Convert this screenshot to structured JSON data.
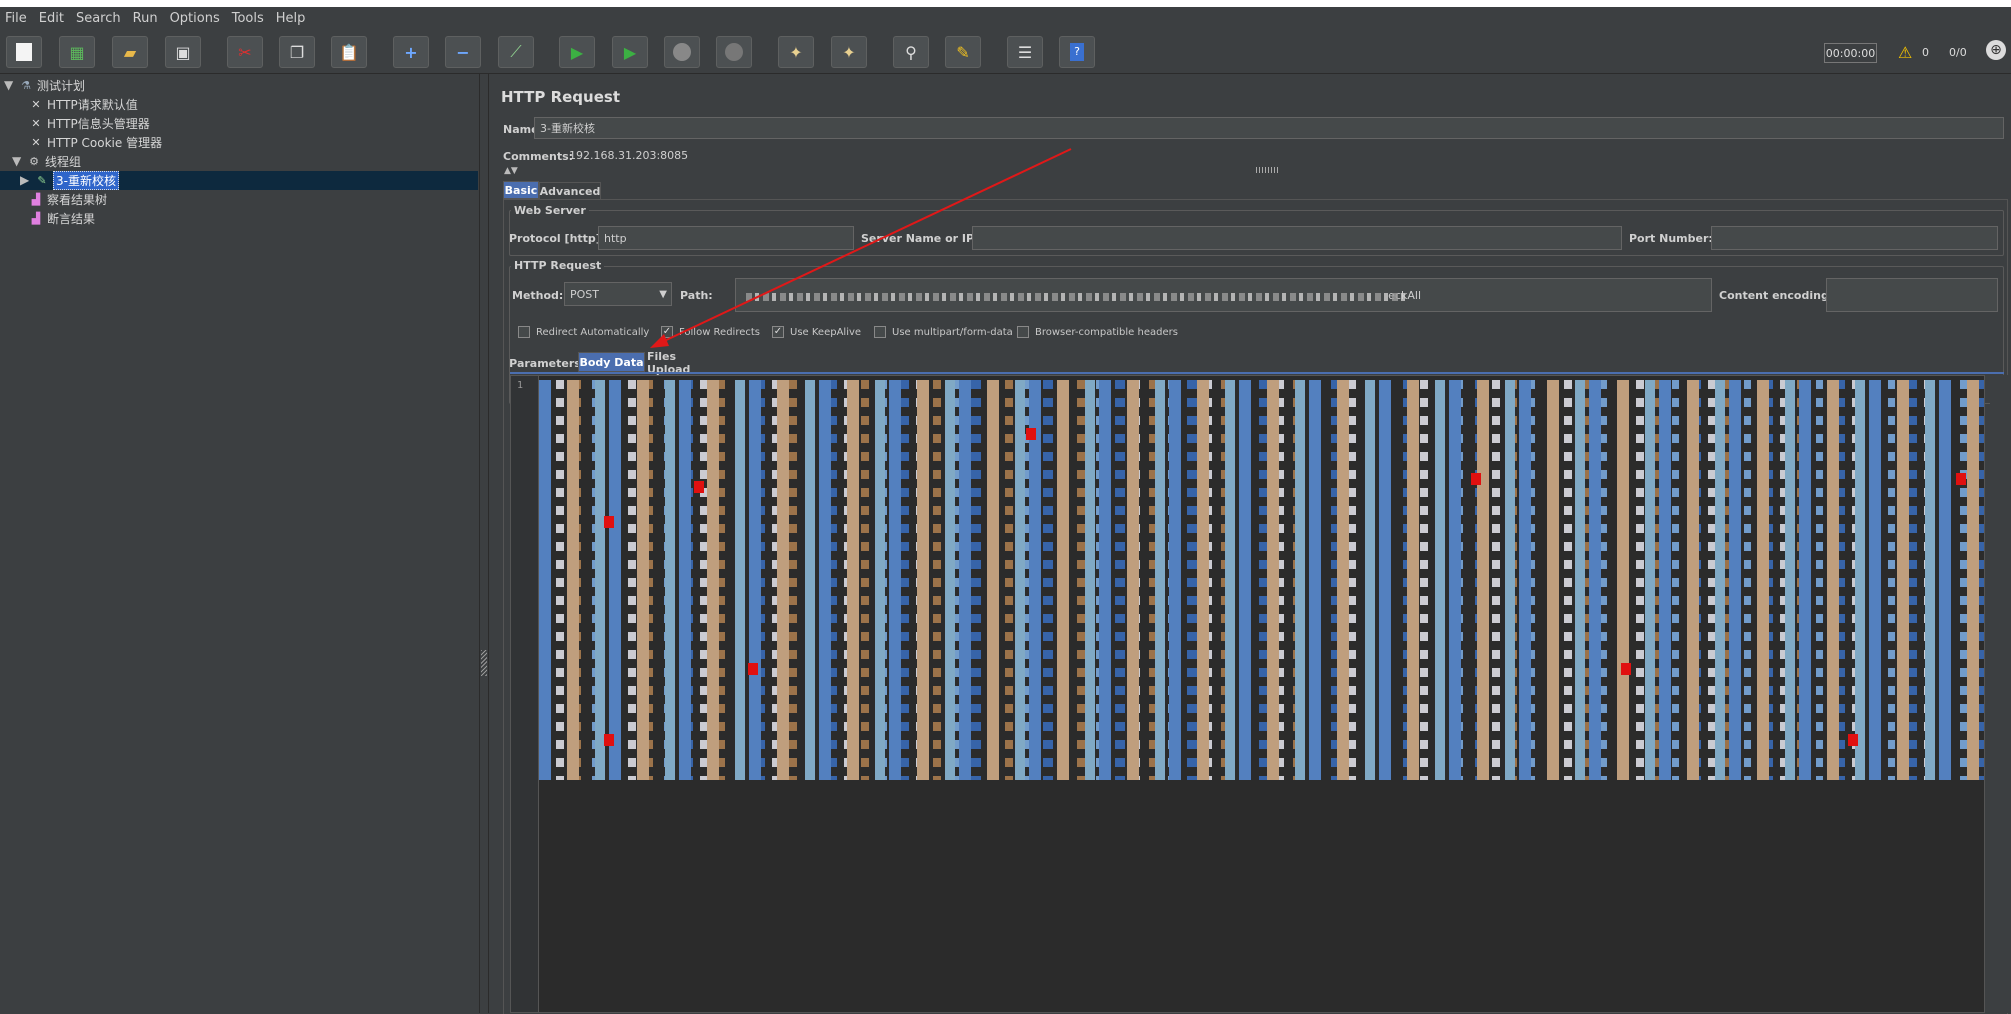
{
  "menu": [
    "File",
    "Edit",
    "Search",
    "Run",
    "Options",
    "Tools",
    "Help"
  ],
  "toolbar": {
    "icons": [
      "new-icon",
      "templates-icon",
      "open-icon",
      "save-icon",
      "cut-icon",
      "copy-icon",
      "paste-icon",
      "expand-icon",
      "collapse-icon",
      "toggle-icon",
      "start-icon",
      "start-no-pauses-icon",
      "stop-icon",
      "shutdown-icon",
      "clear-icon",
      "clear-all-icon",
      "search-icon",
      "reset-search-icon",
      "function-helper-icon",
      "help-icon"
    ],
    "timer": "00:00:00",
    "warning_count": "0",
    "threads": "0/0"
  },
  "tree": {
    "items": [
      {
        "label": "测试计划",
        "icon": "test-plan-icon"
      },
      {
        "label": "HTTP请求默认值",
        "icon": "config-element-icon"
      },
      {
        "label": "HTTP信息头管理器",
        "icon": "config-element-icon"
      },
      {
        "label": "HTTP Cookie 管理器",
        "icon": "config-element-icon"
      },
      {
        "label": "线程组",
        "icon": "thread-group-icon"
      },
      {
        "label": "3-重新校核",
        "icon": "sampler-icon",
        "selected": true
      },
      {
        "label": "察看结果树",
        "icon": "listener-icon"
      },
      {
        "label": "断言结果",
        "icon": "listener-icon"
      }
    ]
  },
  "panel": {
    "title": "HTTP Request",
    "name_label": "Name:",
    "name_value": "3-重新校核",
    "comments_label": "Comments:",
    "comments_value": "192.168.31.203:8085",
    "tabs": [
      "Basic",
      "Advanced"
    ],
    "web_server": {
      "legend": "Web Server",
      "protocol_label": "Protocol [http]:",
      "protocol_value": "http",
      "server_label": "Server Name or IP:",
      "server_value": "",
      "port_label": "Port Number:",
      "port_value": ""
    },
    "http_request": {
      "legend": "HTTP Request",
      "method_label": "Method:",
      "method_value": "POST",
      "path_label": "Path:",
      "path_value": "eckAll",
      "encoding_label": "Content encoding:",
      "encoding_value": ""
    },
    "checkboxes": [
      {
        "label": "Redirect Automatically",
        "checked": false
      },
      {
        "label": "Follow Redirects",
        "checked": true
      },
      {
        "label": "Use KeepAlive",
        "checked": true
      },
      {
        "label": "Use multipart/form-data",
        "checked": false
      },
      {
        "label": "Browser-compatible headers",
        "checked": false
      }
    ],
    "body_tabs": [
      "Parameters",
      "Body Data",
      "Files Upload"
    ],
    "editor_line_number": "1"
  }
}
